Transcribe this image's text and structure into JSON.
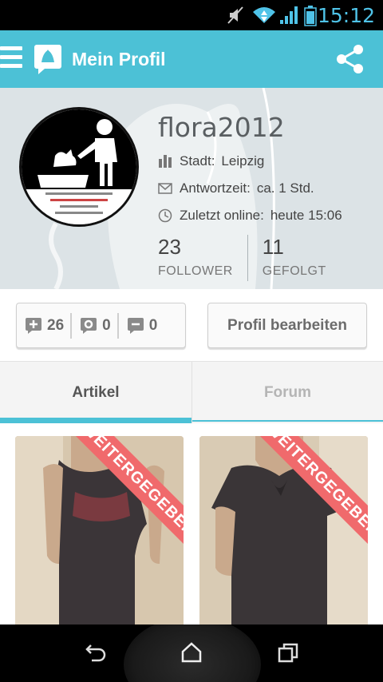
{
  "status_bar": {
    "time": "15:12",
    "icons": [
      "mute-icon",
      "wifi-icon",
      "signal-icon",
      "battery-icon"
    ]
  },
  "action_bar": {
    "title": "Mein Profil",
    "icons": [
      "menu-icon",
      "app-logo-icon",
      "share-icon"
    ],
    "background": "#4cc1d6"
  },
  "profile": {
    "username": "flora2012",
    "city_label": "Stadt:",
    "city_value": "Leipzig",
    "response_label": "Antwortzeit:",
    "response_value": "ca. 1 Std.",
    "last_online_label": "Zuletzt online:",
    "last_online_value": "heute 15:06",
    "followers_count": "23",
    "followers_label": "FOLLOWER",
    "following_count": "11",
    "following_label": "GEFOLGT"
  },
  "ratings": {
    "positive": "26",
    "neutral": "0",
    "negative": "0"
  },
  "edit_button_label": "Profil bearbeiten",
  "tabs": [
    {
      "label": "Artikel",
      "active": true
    },
    {
      "label": "Forum",
      "active": false
    }
  ],
  "articles": [
    {
      "ribbon": "WEITERGEGEBEN"
    },
    {
      "ribbon": "WEITERGEGEBEN"
    }
  ],
  "nav_bar": {
    "icons": [
      "back-icon",
      "home-icon",
      "recent-apps-icon"
    ]
  },
  "colors": {
    "accent": "#4cc1d6",
    "ribbon": "#f06a6c"
  }
}
